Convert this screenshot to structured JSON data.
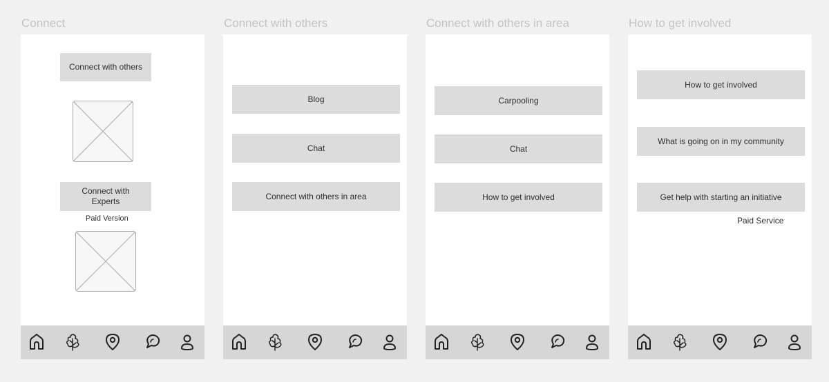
{
  "screens": [
    {
      "title": "Connect",
      "buttons": [
        "Connect with others",
        "Connect with Experts"
      ],
      "note": "Paid Version"
    },
    {
      "title": "Connect with others",
      "buttons": [
        "Blog",
        "Chat",
        "Connect with others in area"
      ]
    },
    {
      "title": "Connect with others in area",
      "buttons": [
        "Carpooling",
        "Chat",
        "How to get involved"
      ]
    },
    {
      "title": "How to get involved",
      "buttons": [
        "How to get involved",
        "What is going on in my community",
        "Get help with starting an initiative"
      ],
      "note": "Paid Service"
    }
  ],
  "nav_icons": [
    "home-icon",
    "tree-icon",
    "location-pin-icon",
    "chat-bubble-icon",
    "user-icon"
  ],
  "colors": {
    "background": "#f1f1f1",
    "frame": "#ffffff",
    "button": "#dcdcdc",
    "navbar": "#d6d6d6",
    "title": "#c4c4c4"
  }
}
